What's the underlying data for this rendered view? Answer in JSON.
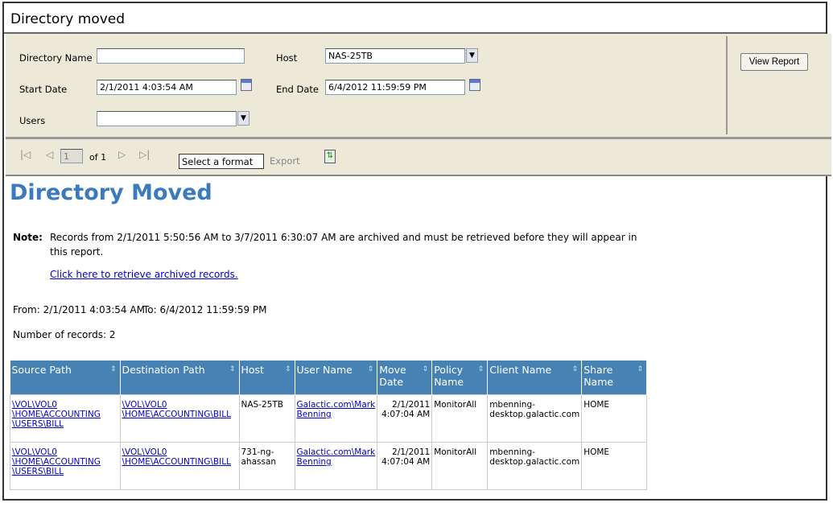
{
  "window": {
    "title": "Directory moved"
  },
  "params": {
    "directory_name": {
      "label": "Directory Name",
      "value": ""
    },
    "host": {
      "label": "Host",
      "value": "NAS-25TB"
    },
    "start_date": {
      "label": "Start Date",
      "value": "2/1/2011 4:03:54 AM"
    },
    "end_date": {
      "label": "End Date",
      "value": "6/4/2012 11:59:59 PM"
    },
    "users": {
      "label": "Users",
      "value": ""
    },
    "view_report": "View Report"
  },
  "toolbar": {
    "page": "1",
    "of": "of 1",
    "format": "Select a format",
    "export": "Export"
  },
  "report": {
    "title": "Directory Moved",
    "note_label": "Note:",
    "note_text": "Records from 2/1/2011 5:50:56 AM to 3/7/2011 6:30:07 AM are archived and must be retrieved before they will appear in",
    "note_text2": "this report.",
    "retrieve_link": "Click here to retrieve archived records.",
    "from": "From: 2/1/2011 4:03:54 AM",
    "to": "To: 6/4/2012 11:59:59 PM",
    "count": "Number of records: 2",
    "columns": [
      "Source Path",
      "Destination  Path",
      "Host",
      "User Name",
      "Move Date",
      "Policy Name",
      "Client Name",
      "Share Name"
    ],
    "rows": [
      [
        "\\VOL\\VOL0 \\HOME\\ACCOUNTING \\USERS\\BILL",
        "\\VOL\\VOL0 \\HOME\\ACCOUNTING\\BILL",
        "NAS-25TB",
        "Galactic.com\\Mark Benning",
        "2/1/2011 4:07:04 AM",
        "MonitorAll",
        "mbenning-desktop.galactic.com",
        "HOME"
      ],
      [
        "\\VOL\\VOL0 \\HOME\\ACCOUNTING \\USERS\\BILL",
        "\\VOL\\VOL0 \\HOME\\ACCOUNTING\\BILL",
        "731-ng-ahassan",
        "Galactic.com\\Mark Benning",
        "2/1/2011 4:07:04 AM",
        "MonitorAll",
        "mbenning-desktop.galactic.com",
        "HOME"
      ]
    ]
  },
  "colors": {
    "header": "#4682b4",
    "title": "#3b7bbd",
    "panel": "#ECE9D8"
  }
}
